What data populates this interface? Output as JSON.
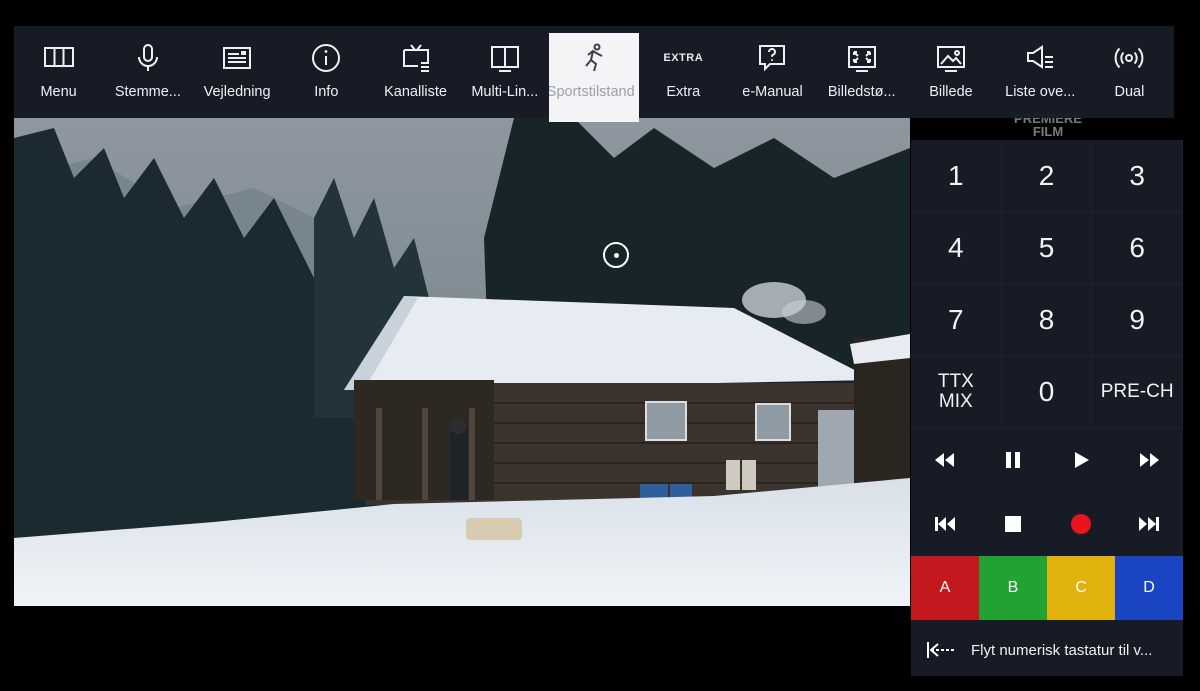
{
  "toolbar": {
    "items": [
      {
        "label": "Menu",
        "icon": "menu-grid-icon"
      },
      {
        "label": "Stemme...",
        "icon": "microphone-icon"
      },
      {
        "label": "Vejledning",
        "icon": "guide-icon"
      },
      {
        "label": "Info",
        "icon": "info-icon"
      },
      {
        "label": "Kanalliste",
        "icon": "tv-list-icon"
      },
      {
        "label": "Multi-Lin...",
        "icon": "multi-link-icon"
      },
      {
        "label": "Sportstilstand",
        "icon": "running-person-icon",
        "active": true
      },
      {
        "label": "Extra",
        "icon": "extra-badge-icon",
        "badge": "EXTRA"
      },
      {
        "label": "e-Manual",
        "icon": "emanual-icon"
      },
      {
        "label": "Billedstø...",
        "icon": "picture-size-icon"
      },
      {
        "label": "Billede",
        "icon": "picture-icon"
      },
      {
        "label": "Liste ove...",
        "icon": "speaker-list-icon"
      },
      {
        "label": "Dual",
        "icon": "dual-broadcast-icon"
      }
    ]
  },
  "watermark": {
    "line1": "PREMIERE",
    "line2": "FILM"
  },
  "keypad": {
    "keys": [
      "1",
      "2",
      "3",
      "4",
      "5",
      "6",
      "7",
      "8",
      "9",
      "TTX\nMIX",
      "0",
      "PRE-CH"
    ],
    "media_row1": [
      "rewind-icon",
      "pause-icon",
      "play-icon",
      "fast-forward-icon"
    ],
    "media_row2": [
      "previous-icon",
      "stop-icon",
      "record-icon",
      "next-icon"
    ],
    "color_keys": [
      {
        "label": "A",
        "color": "#c3181e"
      },
      {
        "label": "B",
        "color": "#22a232"
      },
      {
        "label": "C",
        "color": "#e1b20c"
      },
      {
        "label": "D",
        "color": "#1a44c2"
      }
    ],
    "move_label": "Flyt numerisk tastatur til v..."
  },
  "colors": {
    "panel": "#181c28",
    "active_tab": "#f4f4f6",
    "record": "#e8141e"
  }
}
